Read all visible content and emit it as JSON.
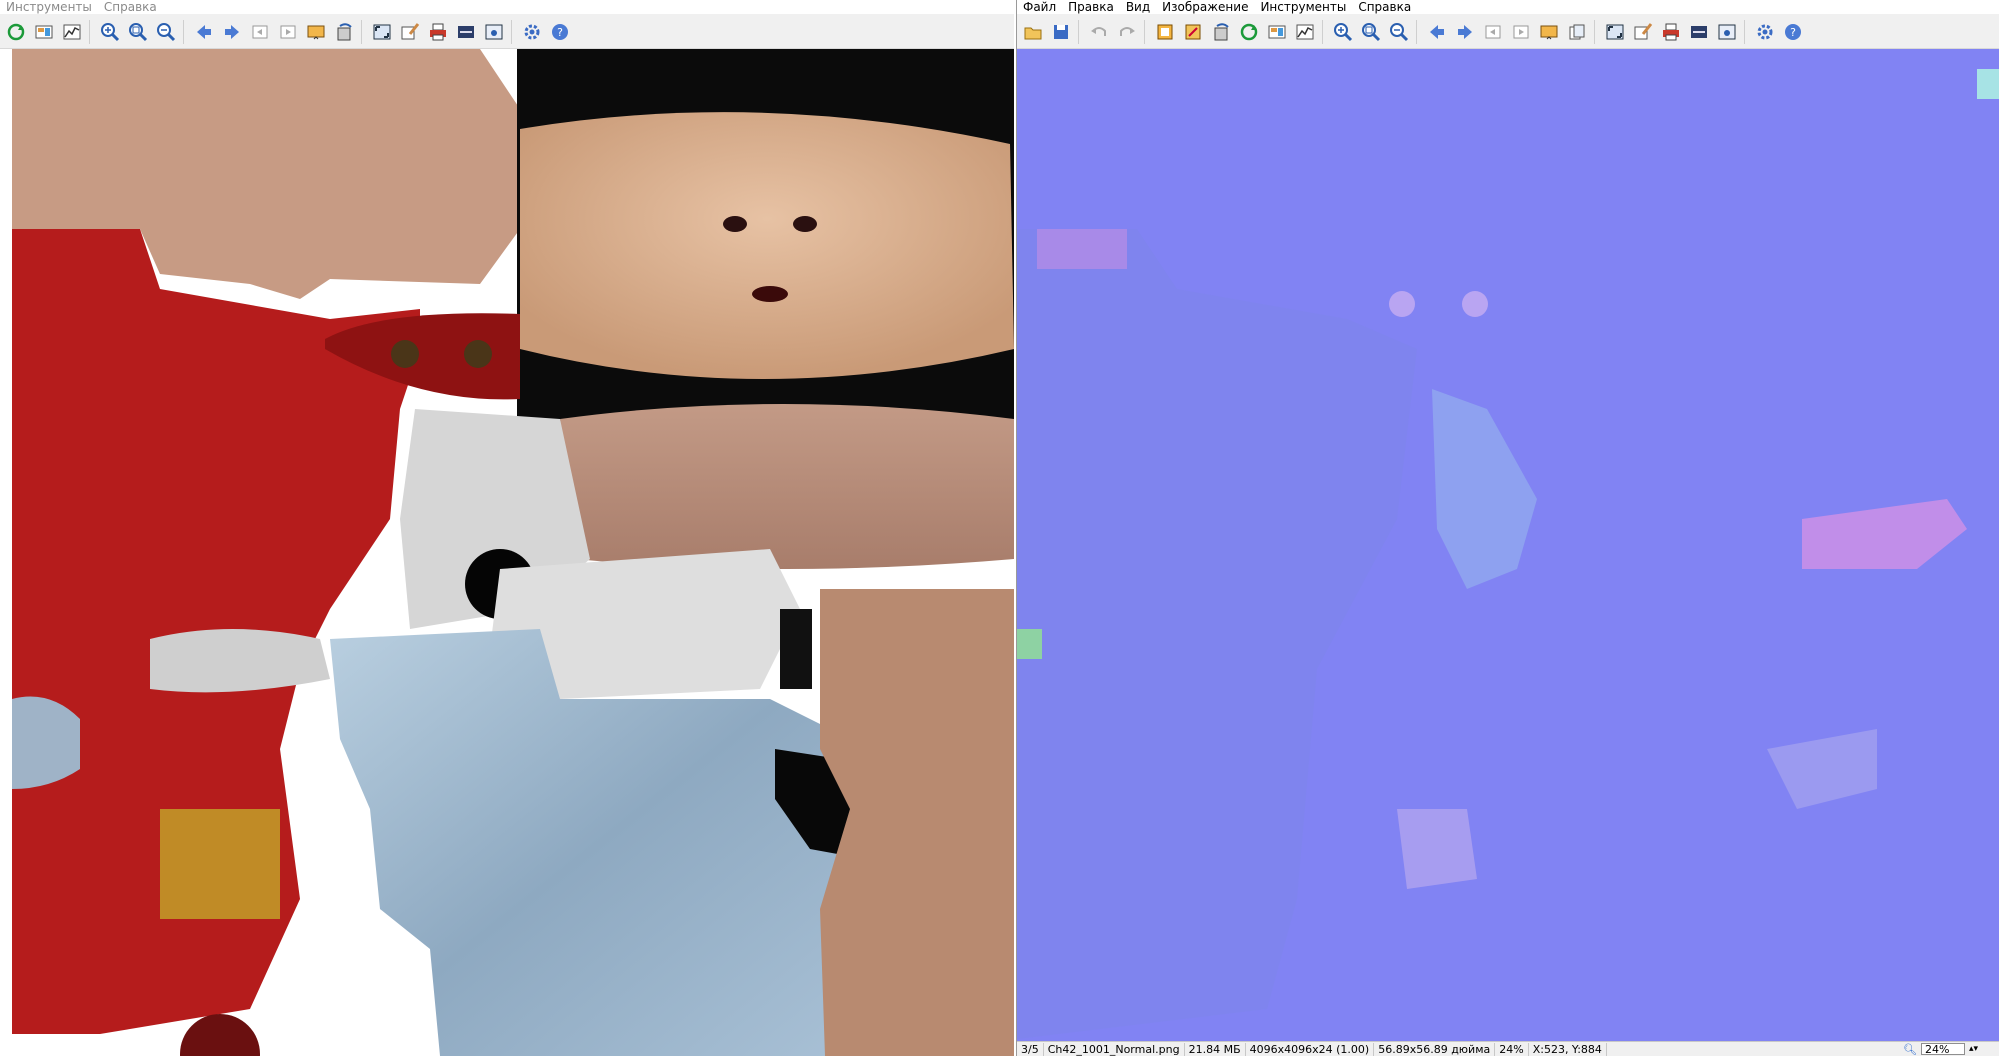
{
  "left_window": {
    "menu": [
      "Инструменты",
      "Справка"
    ],
    "toolbar_icons": [
      "refresh-icon",
      "view-mode-icon",
      "histogram-icon",
      "zoom-in-icon",
      "zoom-fit-icon",
      "zoom-out-icon",
      "back-arrow-icon",
      "forward-arrow-icon",
      "page-prev-icon",
      "page-next-icon",
      "slideshow-icon",
      "rotate-icon",
      "fullscreen-icon",
      "edit-icon",
      "print-icon",
      "scanner-icon",
      "screenshot-icon",
      "settings-gear-icon",
      "help-icon"
    ],
    "image": {
      "alt": "Diffuse color texture atlas"
    }
  },
  "right_window": {
    "menu": [
      "Файл",
      "Правка",
      "Вид",
      "Изображение",
      "Инструменты",
      "Справка"
    ],
    "toolbar_icons": [
      "open-folder-icon",
      "save-icon",
      "undo-icon",
      "redo-icon",
      "crop-icon",
      "resize-icon",
      "rotate-icon",
      "refresh-icon",
      "view-mode-icon",
      "histogram-icon",
      "zoom-in-icon",
      "zoom-fit-icon",
      "zoom-out-icon",
      "back-arrow-icon",
      "forward-arrow-icon",
      "page-prev-icon",
      "page-next-icon",
      "slideshow-icon",
      "copy-icon",
      "fullscreen-icon",
      "edit-icon",
      "print-icon",
      "scanner-icon",
      "screenshot-icon",
      "settings-gear-icon",
      "help-icon"
    ],
    "image": {
      "alt": "Normal map texture atlas"
    },
    "status": {
      "index": "3/5",
      "filename": "Ch42_1001_Normal.png",
      "filesize": "21.84 МБ",
      "dimensions": "4096x4096x24 (1.00)",
      "print_size": "56.89x56.89 дюйма",
      "zoom_percent": "24%",
      "cursor": "X:523, Y:884"
    },
    "zoom_box_value": "24%"
  },
  "colors": {
    "shirt_red": "#b51c1c",
    "normal_blue": "#8183f3",
    "jeans_blue": "#9db8cf",
    "skin": "#c79b84"
  }
}
